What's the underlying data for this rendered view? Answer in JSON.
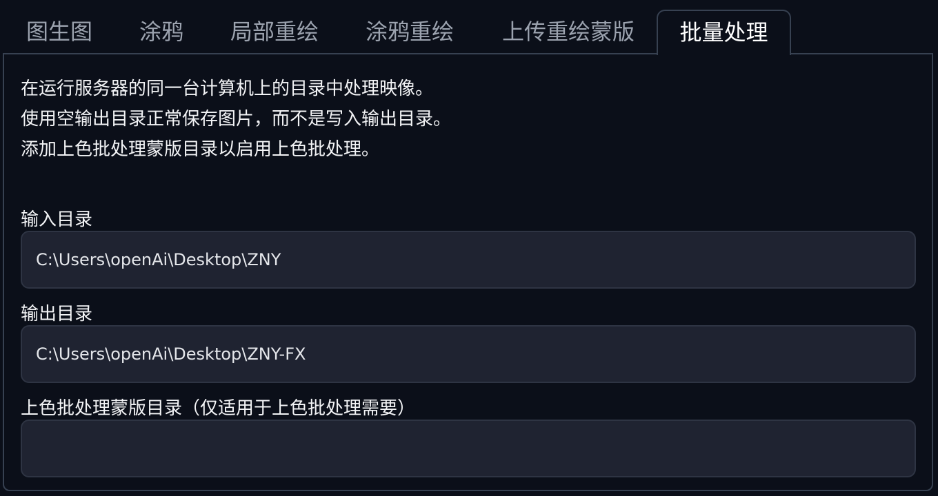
{
  "tabs": [
    {
      "label": "图生图",
      "active": false
    },
    {
      "label": "涂鸦",
      "active": false
    },
    {
      "label": "局部重绘",
      "active": false
    },
    {
      "label": "涂鸦重绘",
      "active": false
    },
    {
      "label": "上传重绘蒙版",
      "active": false
    },
    {
      "label": "批量处理",
      "active": true
    }
  ],
  "description": {
    "line1": "在运行服务器的同一台计算机上的目录中处理映像。",
    "line2": "使用空输出目录正常保存图片，而不是写入输出目录。",
    "line3": "添加上色批处理蒙版目录以启用上色批处理。"
  },
  "fields": {
    "input_dir": {
      "label": "输入目录",
      "value": "C:\\Users\\openAi\\Desktop\\ZNY"
    },
    "output_dir": {
      "label": "输出目录",
      "value": "C:\\Users\\openAi\\Desktop\\ZNY-FX"
    },
    "mask_dir": {
      "label": "上色批处理蒙版目录（仅适用于上色批处理需要）",
      "value": ""
    }
  },
  "colors": {
    "background": "#0b0f19",
    "input_bg": "#1f2331",
    "border": "#374151",
    "active_tab_text": "#ffffff",
    "inactive_tab_text": "#9ca3af"
  }
}
